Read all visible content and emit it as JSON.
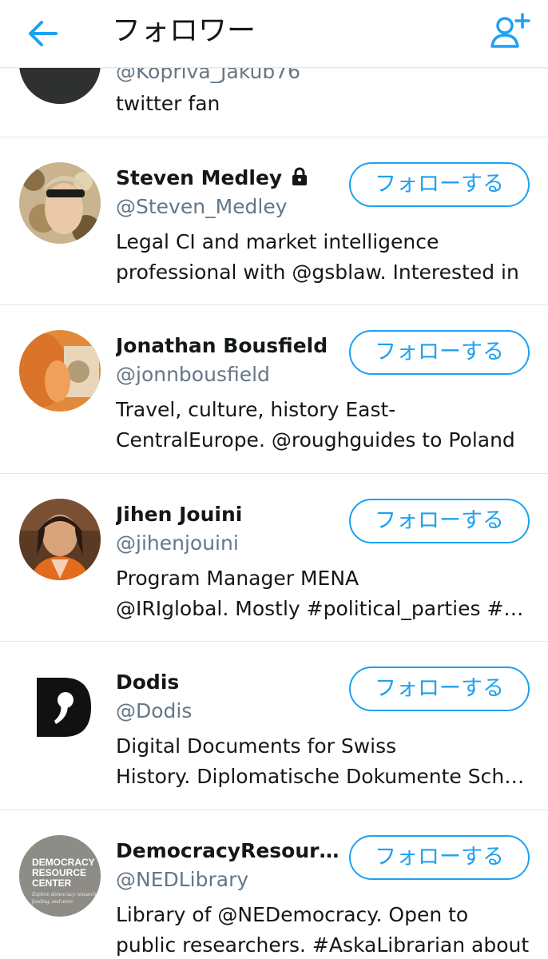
{
  "header": {
    "title": "フォロワー"
  },
  "partial_row": {
    "handle": "@Kopriva_Jakub76",
    "bio": "twitter fan"
  },
  "users": [
    {
      "name": "Steven Medley",
      "handle": "@Steven_Medley",
      "bio1": "Legal CI and market intelligence",
      "bio2": "professional with @gsblaw.  Interested in",
      "follow_label": "フォローする",
      "protected": true
    },
    {
      "name": "Jonathan Bousfield",
      "handle": "@jonnbousfield",
      "bio1": "Travel, culture, history East-",
      "bio2": "CentralEurope. @roughguides to Poland",
      "follow_label": "フォローする"
    },
    {
      "name": "Jihen Jouini",
      "handle": "@jihenjouini",
      "bio1": "Program Manager MENA",
      "bio2": "@IRIglobal. Mostly #political_parties #tunisia",
      "follow_label": "フォローする"
    },
    {
      "name": "Dodis",
      "handle": "@Dodis",
      "bio1": "Digital Documents for Swiss",
      "bio2": "History. Diplomatische Dokumente Schweiz",
      "follow_label": "フォローする"
    },
    {
      "name": "DemocracyResourceCenter",
      "handle": "@NEDLibrary",
      "bio1": "Library of @NEDemocracy. Open to",
      "bio2": "public researchers. #AskaLibrarian about",
      "follow_label": "フォローする",
      "avatar_text": [
        "DEMOCRACY",
        "RESOURCE",
        "CENTER"
      ],
      "avatar_sub": [
        "Explore democracy research,",
        "funding, and more"
      ]
    }
  ],
  "colors": {
    "accent": "#1da1f2",
    "secondary_text": "#657786",
    "divider": "#e1e8ed"
  },
  "icons": {
    "back": "arrow-left-icon",
    "add": "add-user-icon",
    "lock": "lock-icon"
  }
}
